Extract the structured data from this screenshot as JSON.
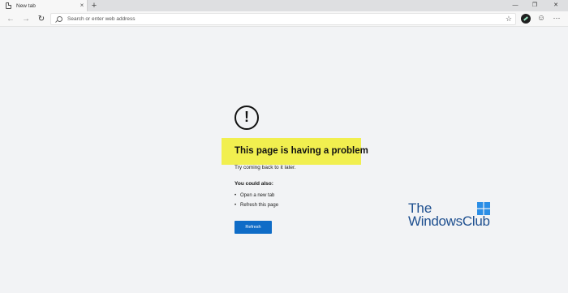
{
  "tab": {
    "title": "New tab",
    "close": "×"
  },
  "new_tab": "+",
  "window_controls": {
    "minimize": "—",
    "restore": "❐",
    "close": "✕"
  },
  "toolbar": {
    "back": "←",
    "forward": "→",
    "refresh": "↻",
    "address_placeholder": "Search or enter web address",
    "favorite": "☆",
    "feedback": "☺",
    "more": "⋯"
  },
  "error": {
    "icon": "!",
    "heading": "This page is having a problem",
    "subtext": "Try coming back to it later.",
    "could_also": "You could also:",
    "suggestions": [
      "Open a new tab",
      "Refresh this page"
    ],
    "refresh_button": "Refresh"
  },
  "watermark": {
    "line1": "The",
    "line2": "WindowsClub"
  },
  "colors": {
    "highlight": "#f1ef4f",
    "button": "#0f6cc7",
    "watermark": "#1e4f8f",
    "background": "#f2f3f5"
  }
}
